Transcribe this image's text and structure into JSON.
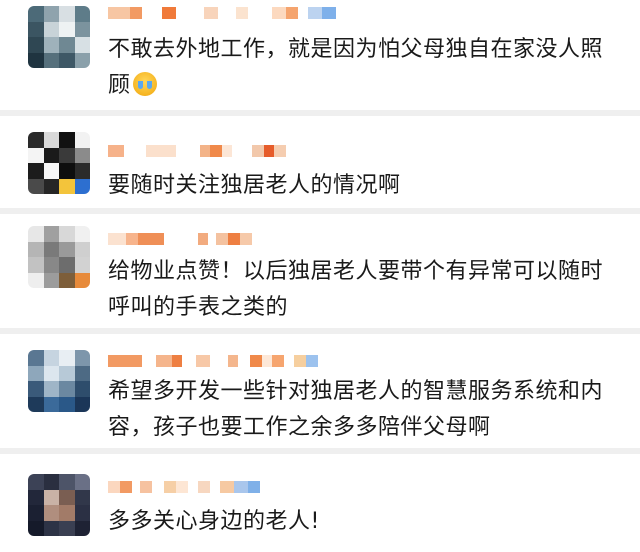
{
  "comments": [
    {
      "text": "不敢去外地工作，就是因为怕父母独自在家没人照顾",
      "emoji": "crying-face-emoji"
    },
    {
      "text": "要随时关注独居老人的情况啊"
    },
    {
      "text": "给物业点赞！以后独居老人要带个有异常可以随时呼叫的手表之类的"
    },
    {
      "text": "希望多开发一些针对独居老人的智慧服务系统和内容，孩子也要工作之余多多陪伴父母啊"
    },
    {
      "text": "多多关心身边的老人!"
    }
  ],
  "colors": {
    "background": "#efefef",
    "card": "#ffffff",
    "text": "#1a1a1a"
  }
}
